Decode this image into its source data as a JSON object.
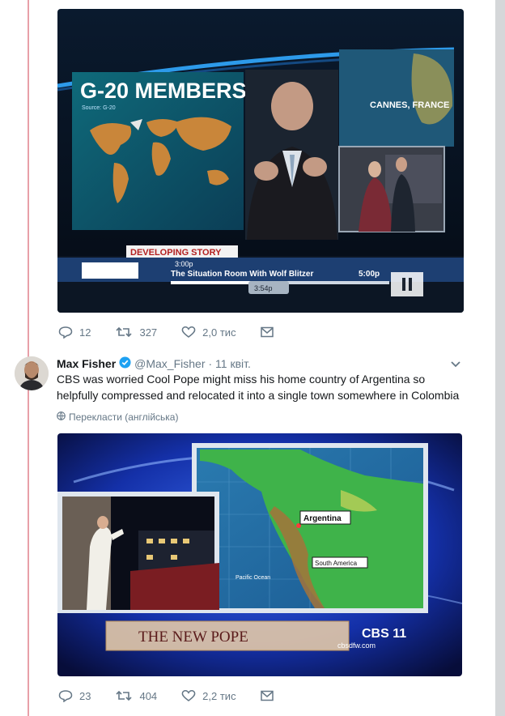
{
  "tweet1": {
    "image": {
      "headline": "G-20 MEMBERS",
      "source": "Source: G-20",
      "location": "CANNES, FRANCE",
      "banner": "DEVELOPING STORY",
      "ticker": "The Situation Room With Wolf Blitzer",
      "time_left": "3:00p",
      "time_right": "5:00p",
      "time_mid": "3:54p"
    },
    "replies": "12",
    "retweets": "327",
    "likes": "2,0 тис"
  },
  "tweet2": {
    "author": {
      "name": "Max Fisher",
      "handle": "@Max_Fisher",
      "date": "· 11 квіт."
    },
    "text": "CBS was worried Cool Pope might miss his home country of Argentina so helpfully compressed and relocated it into a single town somewhere in Colombia",
    "translate": "Перекласти (англійська)",
    "image": {
      "label_argentina": "Argentina",
      "label_south_america": "South America",
      "label_ocean": "Pacific Ocean",
      "lower_third": "THE NEW POPE",
      "station_logo": "CBS 11",
      "station_url": "cbsdfw.com"
    },
    "replies": "23",
    "retweets": "404",
    "likes": "2,2 тис"
  },
  "colors": {
    "thread_line": "#e8a0a8",
    "action_gray": "#657786",
    "verified": "#1da1f2"
  }
}
